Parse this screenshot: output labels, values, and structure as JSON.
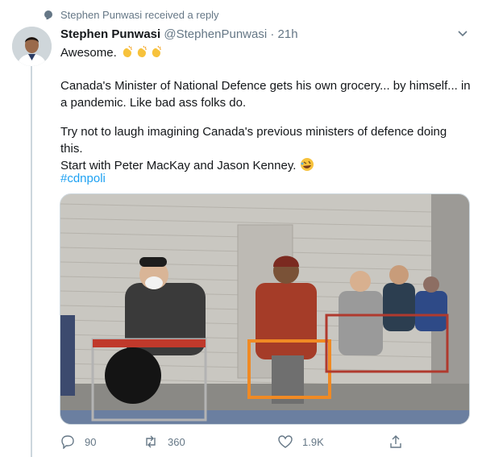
{
  "context": {
    "text": "Stephen Punwasi received a reply"
  },
  "tweet": {
    "author_name": "Stephen Punwasi",
    "handle": "@StephenPunwasi",
    "separator": "·",
    "time": "21h",
    "line1": "Awesome.",
    "paragraph1_line1": "Canada's Minister of National Defence gets his own grocery... by himself... in",
    "paragraph1_line2": "a pandemic. Like bad ass folks do.",
    "paragraph2_line1": "Try not to laugh imagining Canada's previous ministers of defence doing this.",
    "paragraph2_line2": "Start with Peter MacKay and Jason Kenney.",
    "hashtag": "#cdnpoli"
  },
  "actions": {
    "reply_count": "90",
    "retweet_count": "360",
    "like_count": "1.9K"
  },
  "icons": [
    "reply-icon",
    "retweet-icon",
    "like-icon",
    "share-icon",
    "chevron-down-icon",
    "clap-emoji-icon",
    "rofl-emoji-icon"
  ],
  "colors": {
    "link": "#1da1f2",
    "secondary_text": "#657786",
    "primary_text": "#14171a",
    "border": "#ccd6dd"
  }
}
